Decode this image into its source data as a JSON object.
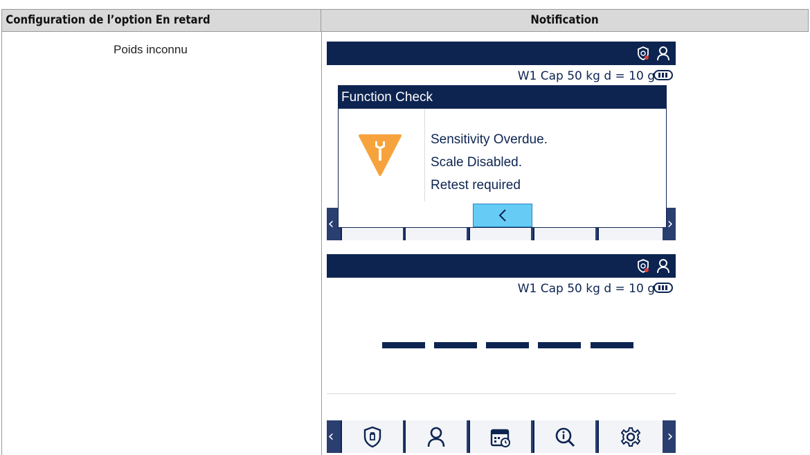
{
  "table": {
    "header_left": "Configuration de l’option En retard",
    "header_right": "Notification",
    "row_label": "Poids inconnu"
  },
  "screen1": {
    "capacity": "W1 Cap 50 kg d = 10 g",
    "dialog_title": "Function Check",
    "messages": [
      "Sensitivity Overdue.",
      "Scale Disabled.",
      "Retest required"
    ]
  },
  "screen2": {
    "capacity": "W1 Cap 50 kg d = 10 g"
  },
  "colors": {
    "navy": "#0d2451",
    "warning": "#f7a33d",
    "back_button": "#66ccf5"
  },
  "icons": [
    "shield-icon",
    "user-icon",
    "calendar-icon",
    "search-icon",
    "gear-icon",
    "wrench-warning-icon",
    "chevron-left-icon",
    "chevron-right-icon"
  ]
}
